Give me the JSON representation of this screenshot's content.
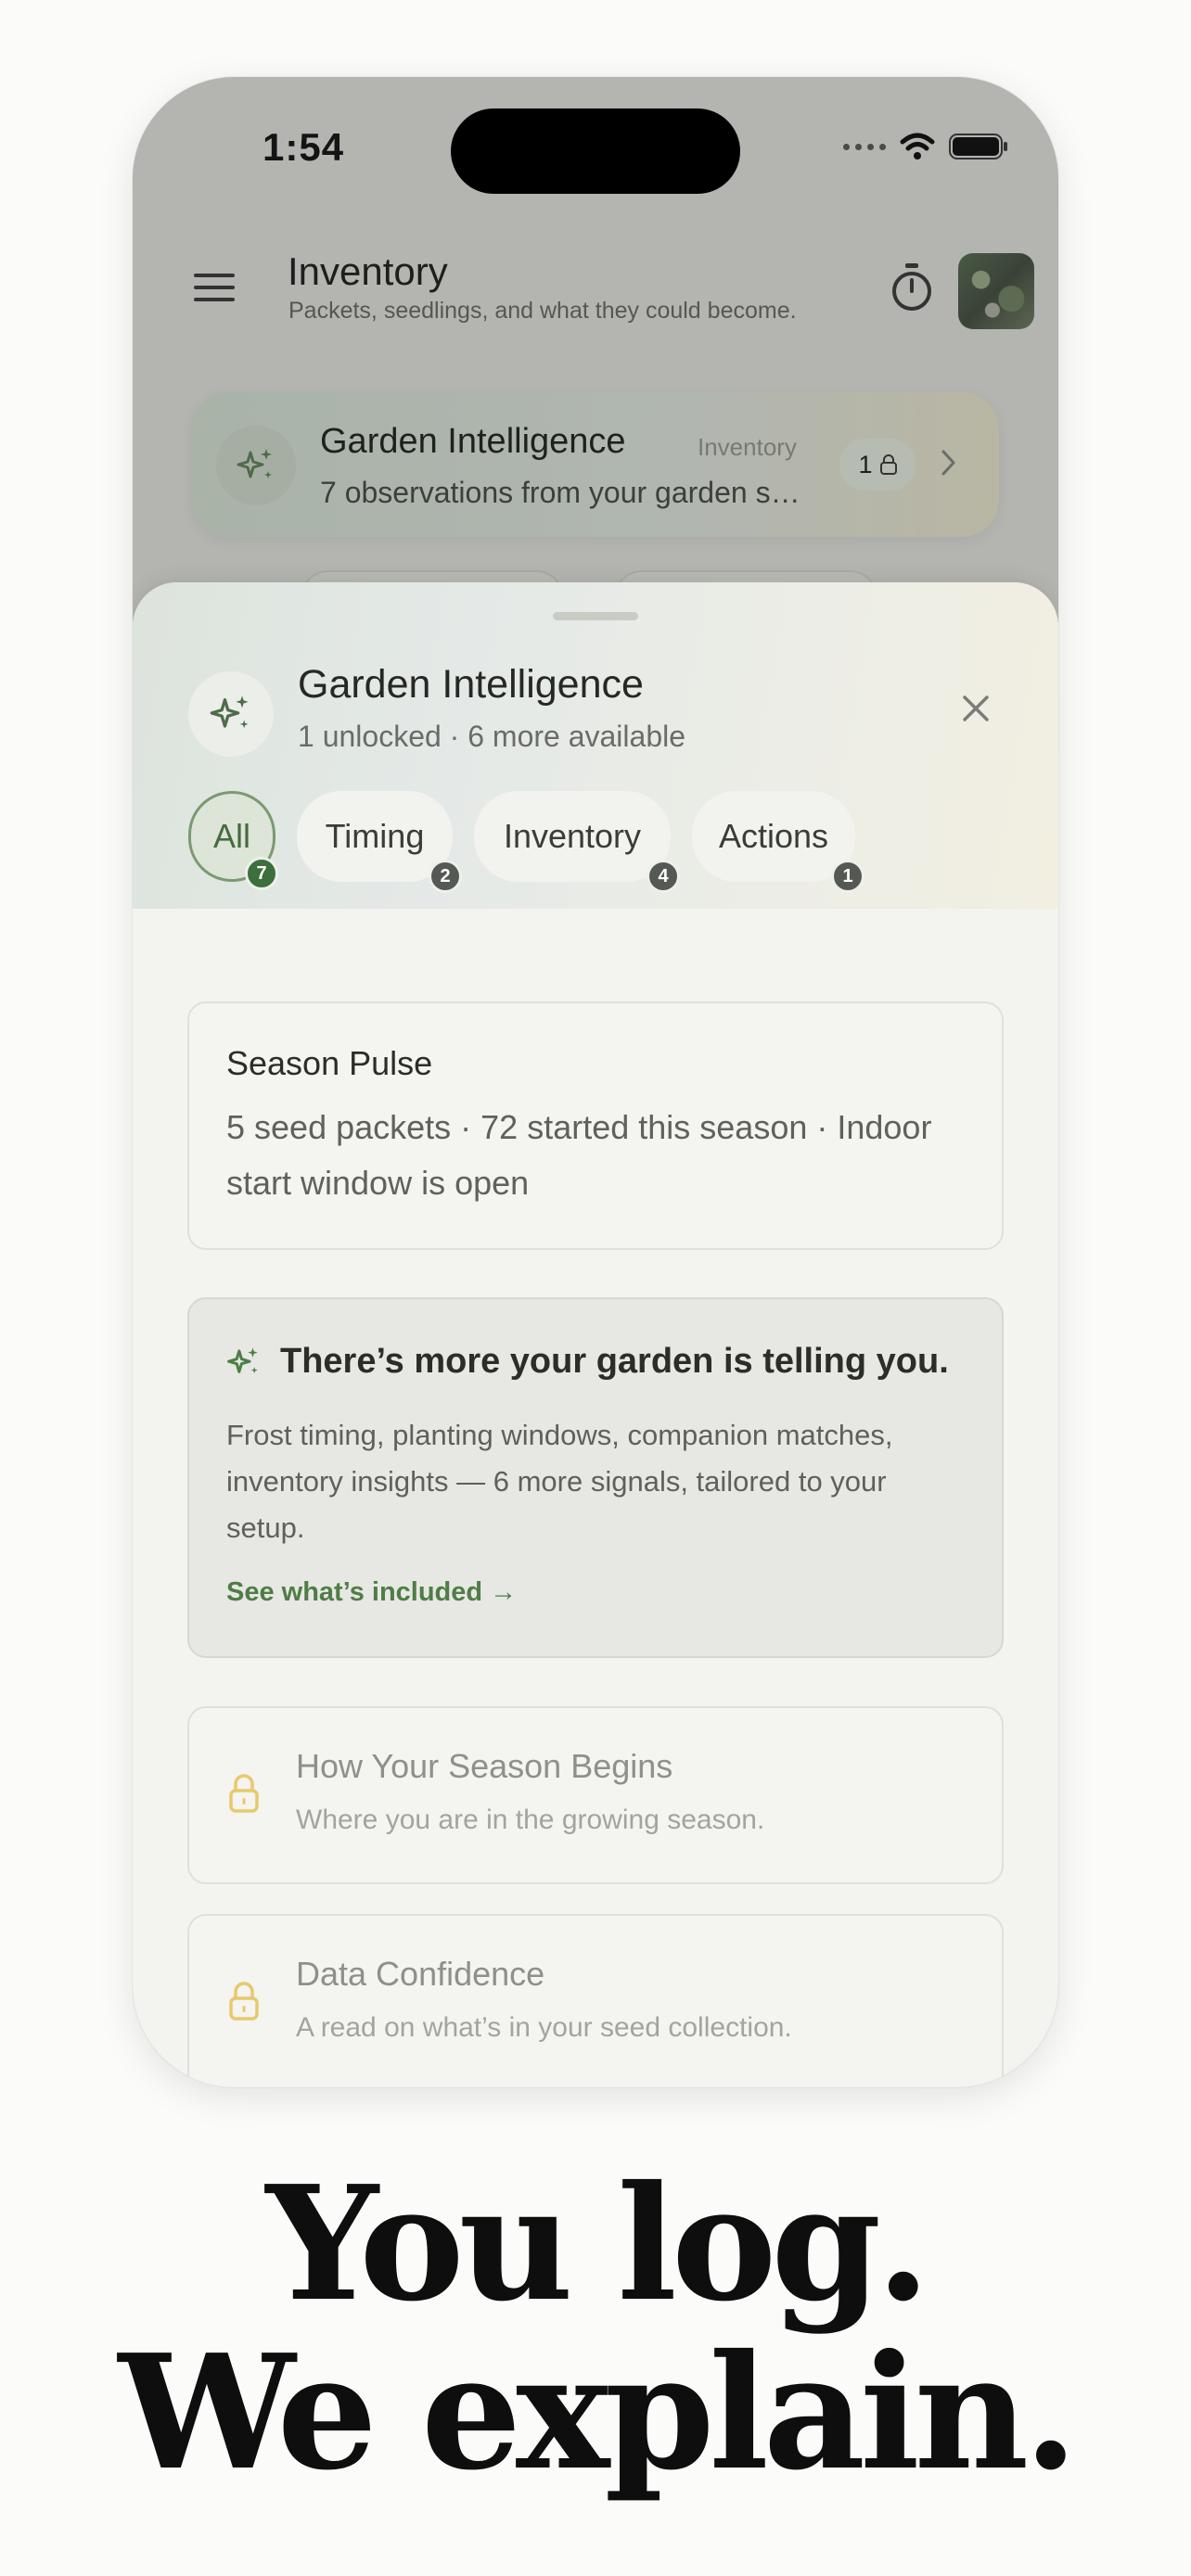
{
  "status_bar": {
    "time": "1:54"
  },
  "header": {
    "title": "Inventory",
    "subtitle": "Packets, seedlings, and what they could become."
  },
  "intelligence_banner": {
    "title": "Garden Intelligence",
    "tag": "Inventory",
    "description": "7 observations from your garden s…",
    "count": "1"
  },
  "sheet": {
    "title": "Garden Intelligence",
    "subtitle": "1 unlocked · 6 more available",
    "tabs": [
      {
        "label": "All",
        "count": "7"
      },
      {
        "label": "Timing",
        "count": "2"
      },
      {
        "label": "Inventory",
        "count": "4"
      },
      {
        "label": "Actions",
        "count": "1"
      }
    ],
    "season_pulse": {
      "title": "Season Pulse",
      "text": "5 seed packets · 72 started this season · Indoor start window is open"
    },
    "promo": {
      "title": "There’s more your garden is telling you.",
      "text": "Frost timing, planting windows, companion matches, inventory insights — 6 more signals, tailored to your setup.",
      "link": "See what’s included →"
    },
    "locked_cards": [
      {
        "title": "How Your Season Begins",
        "subtitle": "Where you are in the growing season."
      },
      {
        "title": "Data Confidence",
        "subtitle": "A read on what’s in your seed collection."
      }
    ]
  },
  "headline": {
    "line1": "You log.",
    "line2": "We explain."
  },
  "colors": {
    "accent_green": "#4f7d46",
    "lock_yellow": "#e8c96a"
  }
}
